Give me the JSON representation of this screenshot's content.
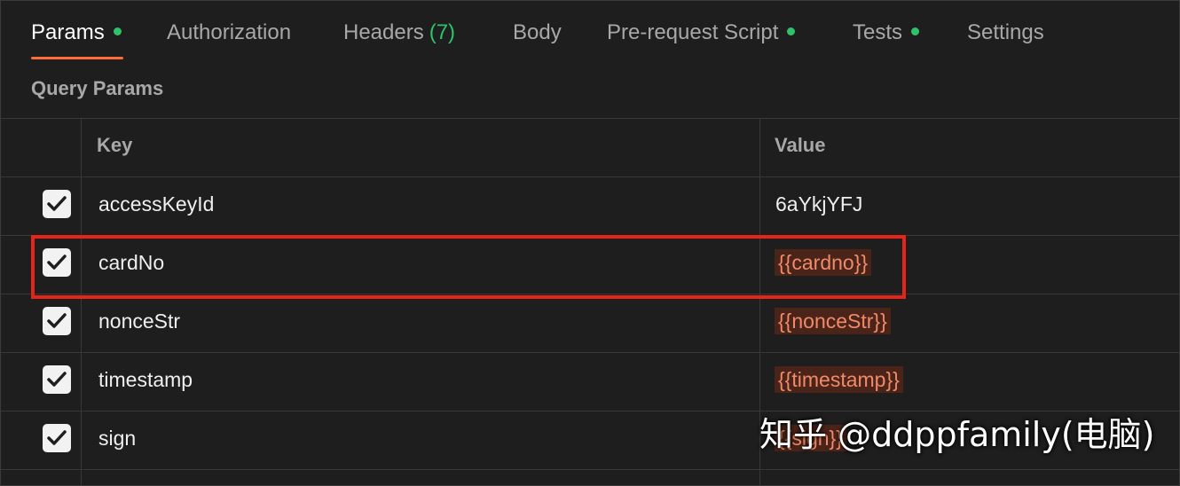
{
  "tabs": [
    {
      "label": "Params",
      "dot": true,
      "active": true
    },
    {
      "label": "Authorization"
    },
    {
      "label": "Headers",
      "count": "(7)"
    },
    {
      "label": "Body"
    },
    {
      "label": "Pre-request Script",
      "dot": true
    },
    {
      "label": "Tests",
      "dot": true
    },
    {
      "label": "Settings"
    }
  ],
  "section_title": "Query Params",
  "columns": {
    "key": "Key",
    "value": "Value"
  },
  "rows": [
    {
      "key": "accessKeyId",
      "value": "6aYkjYFJ",
      "checked": true,
      "is_variable": false
    },
    {
      "key": "cardNo",
      "value": "{{cardno}}",
      "checked": true,
      "is_variable": true
    },
    {
      "key": "nonceStr",
      "value": "{{nonceStr}}",
      "checked": true,
      "is_variable": true
    },
    {
      "key": "timestamp",
      "value": "{{timestamp}}",
      "checked": true,
      "is_variable": true
    },
    {
      "key": "sign",
      "value": "{{sign}}",
      "checked": true,
      "is_variable": true
    }
  ],
  "watermark": "知乎 @ddppfamily(电脑)",
  "colors": {
    "accent": "#ff6c37",
    "dot_green": "#2ec36a",
    "variable_text": "#f08a6b",
    "highlight_box": "#e4261a"
  }
}
